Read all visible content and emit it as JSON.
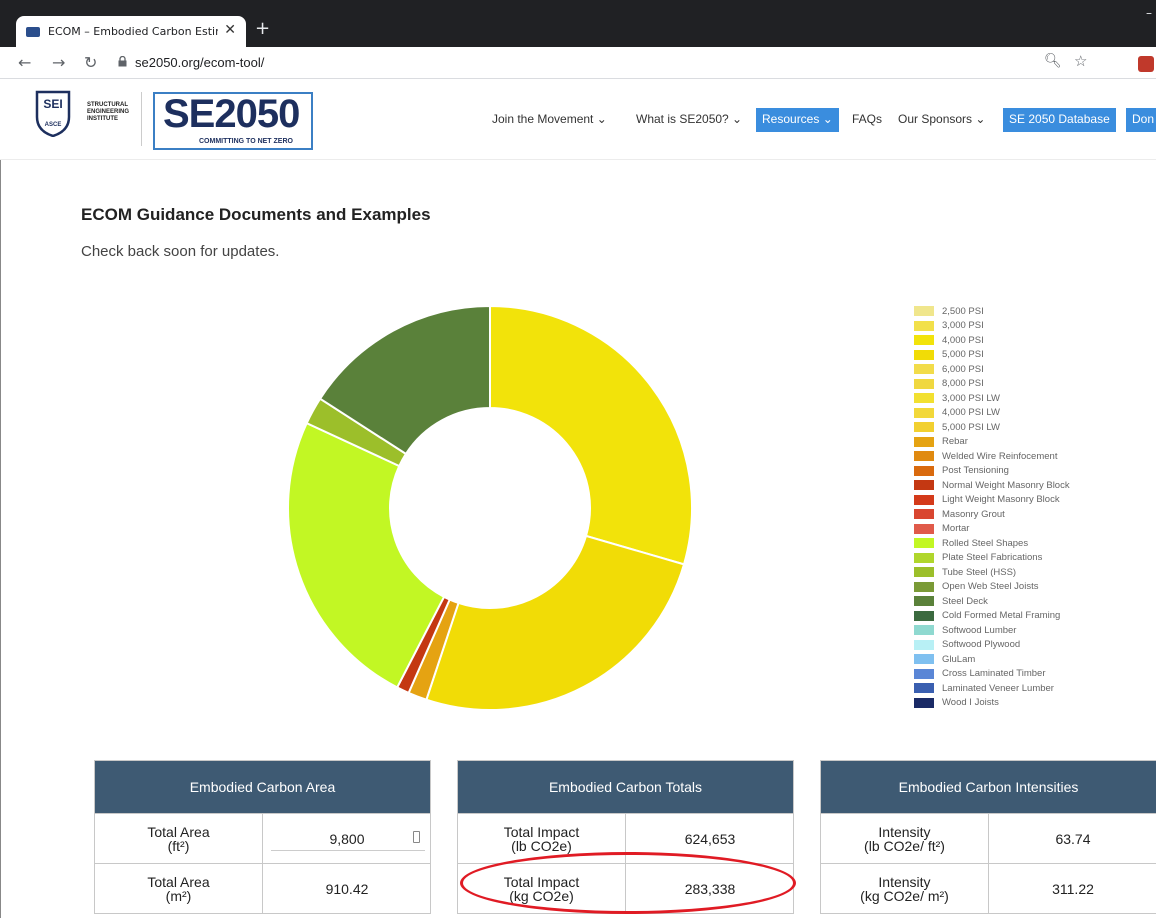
{
  "browser": {
    "tab_title": "ECOM – Embodied Carbon Estim",
    "url": "se2050.org/ecom-tool/"
  },
  "logos": {
    "sel_badge": "SEI",
    "sel_small": "ASCE",
    "sel_text_lines": [
      "STRUCTURAL",
      "ENGINEERING",
      "INSTITUTE"
    ],
    "se_main": "SE2050",
    "se_tagline": "COMMITTING TO NET ZERO"
  },
  "nav": {
    "join": "Join the Movement",
    "what": "What is SE2050?",
    "resources": "Resources",
    "faqs": "FAQs",
    "sponsors": "Our Sponsors",
    "database": "SE 2050 Database",
    "donate": "Don"
  },
  "content": {
    "heading": "ECOM Guidance Documents and Examples",
    "subtext": "Check back soon for updates."
  },
  "chart_data": {
    "type": "pie",
    "donut": true,
    "legend_position": "right",
    "series": [
      {
        "name": "2,500 PSI",
        "value": 0,
        "color": "#f0e68c"
      },
      {
        "name": "3,000 PSI",
        "value": 0,
        "color": "#f2e04a"
      },
      {
        "name": "4,000 PSI",
        "value": 29.5,
        "color": "#f2e30a"
      },
      {
        "name": "5,000 PSI",
        "value": 25.6,
        "color": "#f1dc06"
      },
      {
        "name": "6,000 PSI",
        "value": 0,
        "color": "#f2dc4a"
      },
      {
        "name": "8,000 PSI",
        "value": 0,
        "color": "#f0d840"
      },
      {
        "name": "3,000 PSI LW",
        "value": 0,
        "color": "#f2e030"
      },
      {
        "name": "4,000 PSI LW",
        "value": 0,
        "color": "#f2d83a"
      },
      {
        "name": "5,000 PSI LW",
        "value": 0,
        "color": "#f2d030"
      },
      {
        "name": "Rebar",
        "value": 1.5,
        "color": "#e5a312"
      },
      {
        "name": "Welded Wire Reinfocement",
        "value": 0,
        "color": "#e08a10"
      },
      {
        "name": "Post Tensioning",
        "value": 0,
        "color": "#d96a0e"
      },
      {
        "name": "Normal Weight Masonry Block",
        "value": 1.0,
        "color": "#c43812"
      },
      {
        "name": "Light Weight Masonry Block",
        "value": 0,
        "color": "#d43a1a"
      },
      {
        "name": "Masonry Grout",
        "value": 0,
        "color": "#d94630"
      },
      {
        "name": "Mortar",
        "value": 0,
        "color": "#e05a4a"
      },
      {
        "name": "Rolled Steel Shapes",
        "value": 24.3,
        "color": "#c2f724"
      },
      {
        "name": "Plate Steel Fabrications",
        "value": 0,
        "color": "#b0d62c"
      },
      {
        "name": "Tube Steel (HSS)",
        "value": 2.2,
        "color": "#9cbf2a"
      },
      {
        "name": "Open Web Steel Joists",
        "value": 0,
        "color": "#7a9a36"
      },
      {
        "name": "Steel Deck",
        "value": 15.9,
        "color": "#5a813a"
      },
      {
        "name": "Cold Formed Metal Framing",
        "value": 0,
        "color": "#3b6a3f"
      },
      {
        "name": "Softwood Lumber",
        "value": 0,
        "color": "#8fd9d0"
      },
      {
        "name": "Softwood Plywood",
        "value": 0,
        "color": "#b8f0f5"
      },
      {
        "name": "GluLam",
        "value": 0,
        "color": "#7fc0f0"
      },
      {
        "name": "Cross Laminated Timber",
        "value": 0,
        "color": "#5a86d6"
      },
      {
        "name": "Laminated Veneer Lumber",
        "value": 0,
        "color": "#3a5fb0"
      },
      {
        "name": "Wood I Joists",
        "value": 0,
        "color": "#1a2a66"
      }
    ]
  },
  "panels": {
    "area": {
      "title": "Embodied Carbon Area",
      "row1_label": "Total Area",
      "row1_unit": "(ft²)",
      "row1_value": "9,800",
      "row2_label": "Total Area",
      "row2_unit": "(m²)",
      "row2_value": "910.42"
    },
    "totals": {
      "title": "Embodied Carbon Totals",
      "row1_label": "Total Impact",
      "row1_unit": "(lb CO2e)",
      "row1_value": "624,653",
      "row2_label": "Total Impact",
      "row2_unit": "(kg CO2e)",
      "row2_value": "283,338"
    },
    "intensities": {
      "title": "Embodied Carbon Intensities",
      "row1_label": "Intensity",
      "row1_unit": "(lb CO2e/ ft²)",
      "row1_value": "63.74",
      "row2_label": "Intensity",
      "row2_unit": "(kg CO2e/ m²)",
      "row2_value": "311.22"
    }
  }
}
